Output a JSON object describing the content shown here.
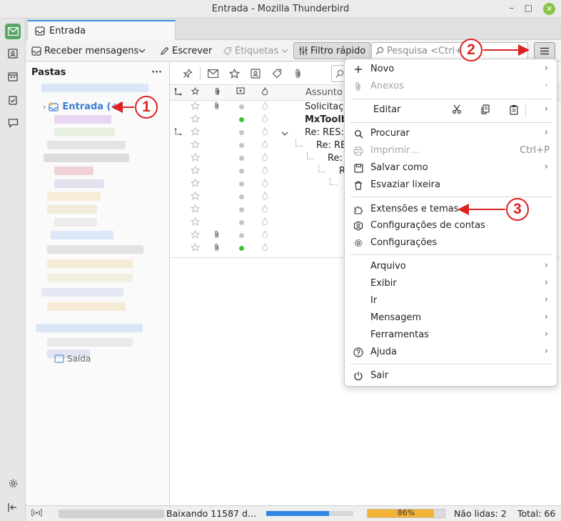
{
  "window": {
    "title": "Entrada - Mozilla Thunderbird",
    "min": "–",
    "max": "□",
    "close": "✕"
  },
  "tab": {
    "label": "Entrada"
  },
  "toolbar": {
    "get_messages": "Receber mensagens",
    "write": "Escrever",
    "tags": "Etiquetas",
    "quick_filter": "Filtro rápido",
    "search_placeholder": "Pesquisa <Ctrl+K>"
  },
  "folders": {
    "header": "Pastas",
    "more": "···",
    "inbox_label": "Entrada (+)",
    "sent_label": "Saída"
  },
  "threads": {
    "subject_header": "Assunto",
    "rows": [
      {
        "subject": "Solicitação",
        "bold": false,
        "indent": 0,
        "attach": true,
        "unread": false
      },
      {
        "subject": "MxToolb",
        "bold": true,
        "indent": 0,
        "attach": false,
        "unread": true
      },
      {
        "subject": "Re: RES: C",
        "bold": false,
        "indent": 0,
        "attach": false,
        "unread": false,
        "thread": true
      },
      {
        "subject": "Re: RES",
        "bold": false,
        "indent": 1,
        "attach": false,
        "unread": false
      },
      {
        "subject": "Re:",
        "bold": false,
        "indent": 2,
        "attach": false,
        "unread": false
      },
      {
        "subject": "R",
        "bold": false,
        "indent": 3,
        "attach": false,
        "unread": false
      },
      {
        "subject": "",
        "bold": false,
        "indent": 4,
        "attach": false,
        "unread": false
      },
      {
        "subject": "",
        "bold": false,
        "indent": 0,
        "attach": false,
        "unread": false
      },
      {
        "subject": "",
        "bold": false,
        "indent": 0,
        "attach": false,
        "unread": false
      },
      {
        "subject": "",
        "bold": false,
        "indent": 0,
        "attach": false,
        "unread": false
      },
      {
        "subject": "",
        "bold": false,
        "indent": 0,
        "attach": true,
        "unread": false
      },
      {
        "subject": "",
        "bold": false,
        "indent": 0,
        "attach": true,
        "unread": true
      }
    ]
  },
  "menu": {
    "new": "Novo",
    "attachments": "Anexos",
    "edit": "Editar",
    "find": "Procurar",
    "print": "Imprimir…",
    "print_shortcut": "Ctrl+P",
    "save_as": "Salvar como",
    "empty_trash": "Esvaziar lixeira",
    "addons": "Extensões e temas",
    "account_settings": "Configurações de contas",
    "settings": "Configurações",
    "file": "Arquivo",
    "view": "Exibir",
    "go": "Ir",
    "message": "Mensagem",
    "tools": "Ferramentas",
    "help": "Ajuda",
    "quit": "Sair"
  },
  "status": {
    "downloading": "Baixando 11587 d…",
    "progress_pct": "86%",
    "progress_value": 0.86,
    "download_fraction": 0.72,
    "unread": "Não lidas: 2",
    "total": "Total: 66"
  },
  "callouts": {
    "one": "1",
    "two": "2",
    "three": "3"
  },
  "colors": {
    "accent": "#3a8ee6",
    "callout": "#dd2222",
    "progress": "#f5b335",
    "spaces_active": "#57a867"
  }
}
